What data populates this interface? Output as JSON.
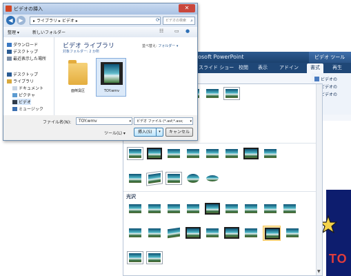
{
  "powerpoint": {
    "title": "rosoft PowerPoint",
    "context_tab": "ビデオ ツール",
    "tabs": [
      "スライド ショー",
      "校閲",
      "表示",
      "アドイン",
      "書式",
      "再生"
    ],
    "active_tab_index": 4,
    "ribbon_right": [
      "ビデオの",
      "ビデオの",
      "ビデオの"
    ],
    "slide_text": "TO",
    "gallery": {
      "section_label": "光沢",
      "selected_style_row": 4,
      "selected_style_col": 7
    }
  },
  "dialog": {
    "title": "ビデオの挿入",
    "address": {
      "path_sep": "▸",
      "path": [
        "ライブラリ",
        "ビデオ"
      ],
      "search_placeholder": "ビデオの検索"
    },
    "toolbar": {
      "organize": "整理 ▾",
      "new_folder": "新しいフォルダー"
    },
    "sidebar": {
      "items": [
        {
          "label": "ダウンロード",
          "icon": "download-folder-icon",
          "sub": false
        },
        {
          "label": "デスクトップ",
          "icon": "desktop-icon",
          "sub": false
        },
        {
          "label": "最近表示した場所",
          "icon": "recent-places-icon",
          "sub": false
        },
        {
          "label": "デスクトップ",
          "icon": "desktop-icon",
          "sub": false
        },
        {
          "label": "ライブラリ",
          "icon": "library-icon",
          "sub": false
        },
        {
          "label": "ドキュメント",
          "icon": "documents-icon",
          "sub": true
        },
        {
          "label": "ピクチャ",
          "icon": "pictures-icon",
          "sub": true
        },
        {
          "label": "ビデオ",
          "icon": "video-library-icon",
          "sub": true
        },
        {
          "label": "ミュージック",
          "icon": "music-icon",
          "sub": true
        }
      ]
    },
    "content": {
      "library_title": "ビデオ ライブラリ",
      "library_subtitle": "対象フォルダー: 2 か所",
      "arrange_label": "並べ替え:",
      "arrange_value": "フォルダー ▾",
      "files": [
        {
          "name": "面倒臭区",
          "type": "folder"
        },
        {
          "name": "TOY.wmv",
          "type": "video"
        }
      ]
    },
    "bottom": {
      "filename_label": "ファイル名(N):",
      "filename_value": "TOY.wmv",
      "filetype_value": "ビデオ ファイル (*.asf;*.asx;",
      "tools_label": "ツール(L) ▾",
      "insert_label": "挿入(S)",
      "cancel_label": "キャンセル"
    }
  },
  "colors": {
    "ppt_title_bar": "#1c416e",
    "dialog_title_bar": "#a9c2e3",
    "selection_highlight": "#fde5a7"
  }
}
